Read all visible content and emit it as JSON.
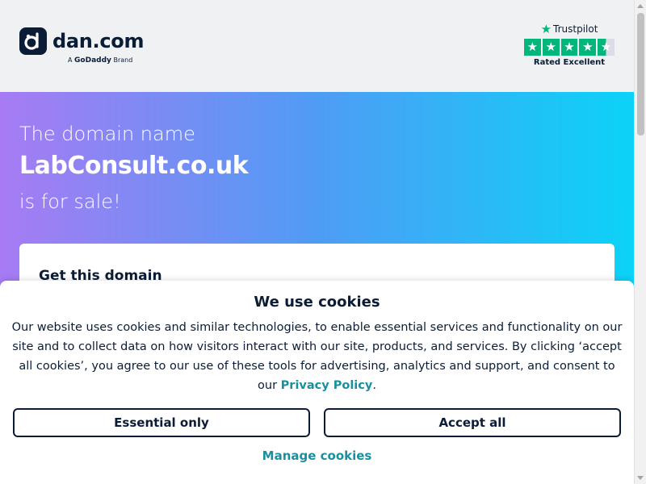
{
  "header": {
    "logo_text": "dan.com",
    "brand_prefix": "A",
    "brand_name": "GoDaddy",
    "brand_suffix": "Brand",
    "trustpilot": {
      "name": "Trustpilot",
      "rating_text": "Rated Excellent",
      "stars": 4.5,
      "color": "#00b67a"
    }
  },
  "hero": {
    "line1": "The domain name",
    "domain": "LabConsult.co.uk",
    "line3": "is for sale!",
    "gradient": [
      "#a77bf3",
      "#4f9cf5",
      "#0bd3f7"
    ]
  },
  "card": {
    "title": "Get this domain"
  },
  "cookie_banner": {
    "title": "We use cookies",
    "text": "Our website uses cookies and similar technologies, to enable essential services and functionality on our site and to collect data on how visitors interact with our site, products, and services. By clicking ‘accept all cookies’, you agree to our use of these tools for advertising, analytics and support, and consent to our",
    "privacy_link": "Privacy Policy",
    "text_end": ".",
    "essential_button": "Essential only",
    "accept_button": "Accept all",
    "manage_link": "Manage cookies",
    "link_color": "#1a8fa0"
  }
}
